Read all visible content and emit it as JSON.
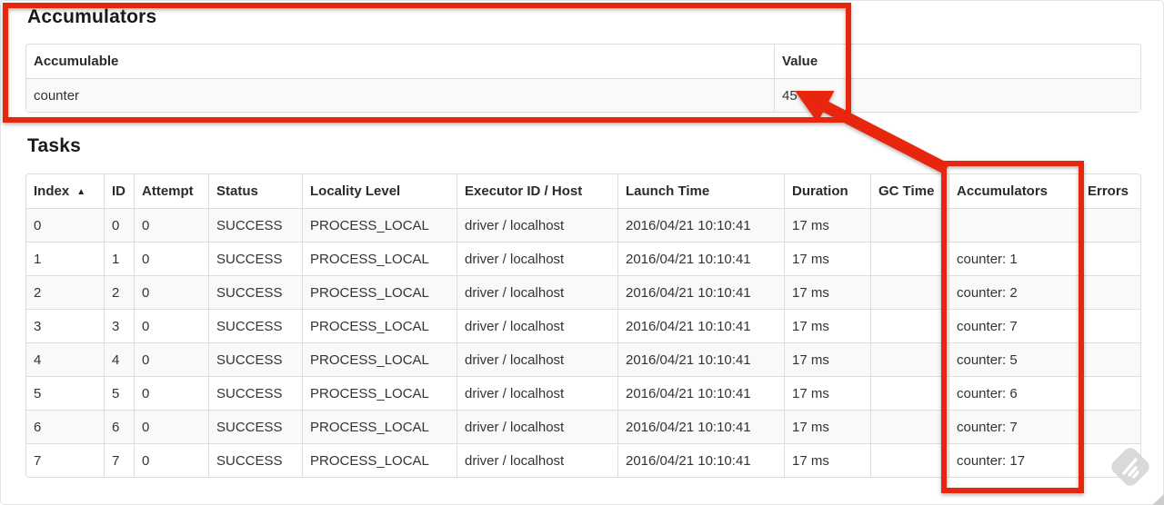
{
  "page": {
    "accumulators_heading": "Accumulators",
    "tasks_heading": "Tasks"
  },
  "accumulators_table": {
    "headers": [
      "Accumulable",
      "Value"
    ],
    "rows": [
      {
        "name": "counter",
        "value": "45"
      }
    ]
  },
  "tasks_table": {
    "headers": [
      "Index",
      "ID",
      "Attempt",
      "Status",
      "Locality Level",
      "Executor ID / Host",
      "Launch Time",
      "Duration",
      "GC Time",
      "Accumulators",
      "Errors"
    ],
    "sort_icon": "▲",
    "sorted_column": "Index",
    "rows": [
      [
        "0",
        "0",
        "0",
        "SUCCESS",
        "PROCESS_LOCAL",
        "driver / localhost",
        "2016/04/21 10:10:41",
        "17 ms",
        "",
        "",
        ""
      ],
      [
        "1",
        "1",
        "0",
        "SUCCESS",
        "PROCESS_LOCAL",
        "driver / localhost",
        "2016/04/21 10:10:41",
        "17 ms",
        "",
        "counter: 1",
        ""
      ],
      [
        "2",
        "2",
        "0",
        "SUCCESS",
        "PROCESS_LOCAL",
        "driver / localhost",
        "2016/04/21 10:10:41",
        "17 ms",
        "",
        "counter: 2",
        ""
      ],
      [
        "3",
        "3",
        "0",
        "SUCCESS",
        "PROCESS_LOCAL",
        "driver / localhost",
        "2016/04/21 10:10:41",
        "17 ms",
        "",
        "counter: 7",
        ""
      ],
      [
        "4",
        "4",
        "0",
        "SUCCESS",
        "PROCESS_LOCAL",
        "driver / localhost",
        "2016/04/21 10:10:41",
        "17 ms",
        "",
        "counter: 5",
        ""
      ],
      [
        "5",
        "5",
        "0",
        "SUCCESS",
        "PROCESS_LOCAL",
        "driver / localhost",
        "2016/04/21 10:10:41",
        "17 ms",
        "",
        "counter: 6",
        ""
      ],
      [
        "6",
        "6",
        "0",
        "SUCCESS",
        "PROCESS_LOCAL",
        "driver / localhost",
        "2016/04/21 10:10:41",
        "17 ms",
        "",
        "counter: 7",
        ""
      ],
      [
        "7",
        "7",
        "0",
        "SUCCESS",
        "PROCESS_LOCAL",
        "driver / localhost",
        "2016/04/21 10:10:41",
        "17 ms",
        "",
        "counter: 17",
        ""
      ]
    ]
  },
  "annotations": {
    "highlight_color": "#e8250d",
    "arrow_points_to_value": "45",
    "boxed_regions": [
      "accumulators-section",
      "accumulators-column"
    ]
  },
  "colors": {
    "table_border": "#dddddd",
    "striped_row": "#f9f9f9",
    "text": "#333333",
    "watermark_gray": "#d9d9d9"
  }
}
